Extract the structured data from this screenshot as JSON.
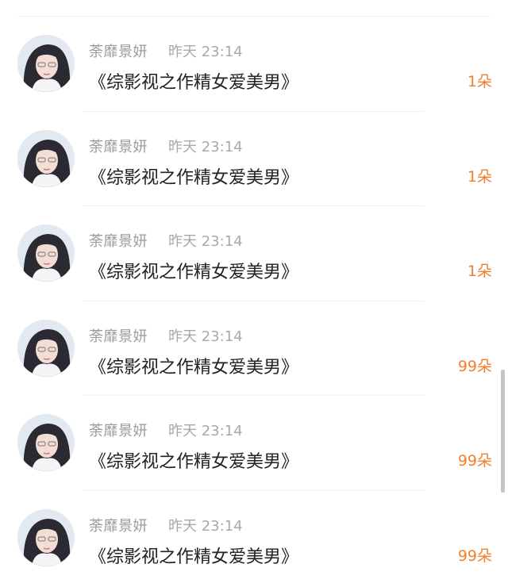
{
  "messages": [
    {
      "sender": "荼靡景妍",
      "time": "昨天 23:14",
      "title": "《综影视之作精女爱美男》",
      "amount": "1朵",
      "avatar_icon": "user-avatar-photo"
    },
    {
      "sender": "荼靡景妍",
      "time": "昨天 23:14",
      "title": "《综影视之作精女爱美男》",
      "amount": "1朵",
      "avatar_icon": "user-avatar-photo"
    },
    {
      "sender": "荼靡景妍",
      "time": "昨天 23:14",
      "title": "《综影视之作精女爱美男》",
      "amount": "1朵",
      "avatar_icon": "user-avatar-photo"
    },
    {
      "sender": "荼靡景妍",
      "time": "昨天 23:14",
      "title": "《综影视之作精女爱美男》",
      "amount": "99朵",
      "avatar_icon": "user-avatar-photo"
    },
    {
      "sender": "荼靡景妍",
      "time": "昨天 23:14",
      "title": "《综影视之作精女爱美男》",
      "amount": "99朵",
      "avatar_icon": "user-avatar-photo"
    },
    {
      "sender": "荼靡景妍",
      "time": "昨天 23:14",
      "title": "《综影视之作精女爱美男》",
      "amount": "99朵",
      "avatar_icon": "user-avatar-photo"
    }
  ],
  "colors": {
    "sender_text": "#9b9b9b",
    "time_text": "#a9a9a9",
    "title_text": "#222222",
    "amount_text": "#f0802e",
    "divider": "#f1f1f1",
    "scrollbar": "#c4c4c4"
  }
}
